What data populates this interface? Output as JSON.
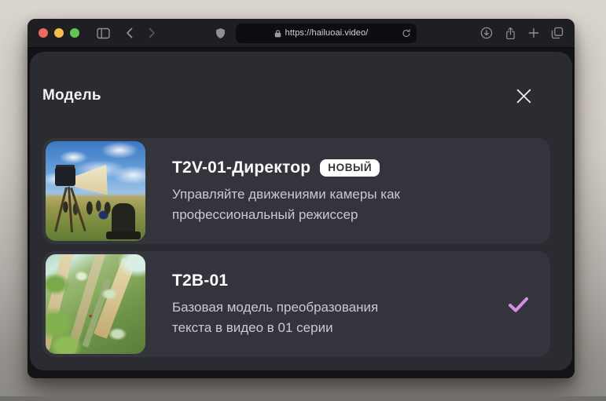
{
  "browser": {
    "url": "https://hailuoai.video/",
    "traffic_lights": {
      "red": "#ed6a5e",
      "yellow": "#f5bf4f",
      "green": "#61c554"
    },
    "toolbar_icon_names": [
      "sidebar",
      "back",
      "forward",
      "privacy-shield",
      "lock",
      "reload",
      "downloads",
      "share",
      "new-tab",
      "tab-overview"
    ]
  },
  "modal": {
    "title": "Модель",
    "check_color": "#d78fe6",
    "badge_bg": "#ffffff",
    "badge_text_color": "#35353c",
    "models": [
      {
        "name": "T2V-01-Директор",
        "badge": "НОВЫЙ",
        "description": "Управляйте движениями камеры как\nпрофессиональный режиссер",
        "selected": false,
        "thumbnail_label": "film-set-megaphone-on-tripod"
      },
      {
        "name": "T2B-01",
        "description": "Базовая модель преобразования\nтекста в видео в 01 серии",
        "selected": true,
        "thumbnail_label": "aerial-view-green-skyscrapers"
      }
    ]
  }
}
